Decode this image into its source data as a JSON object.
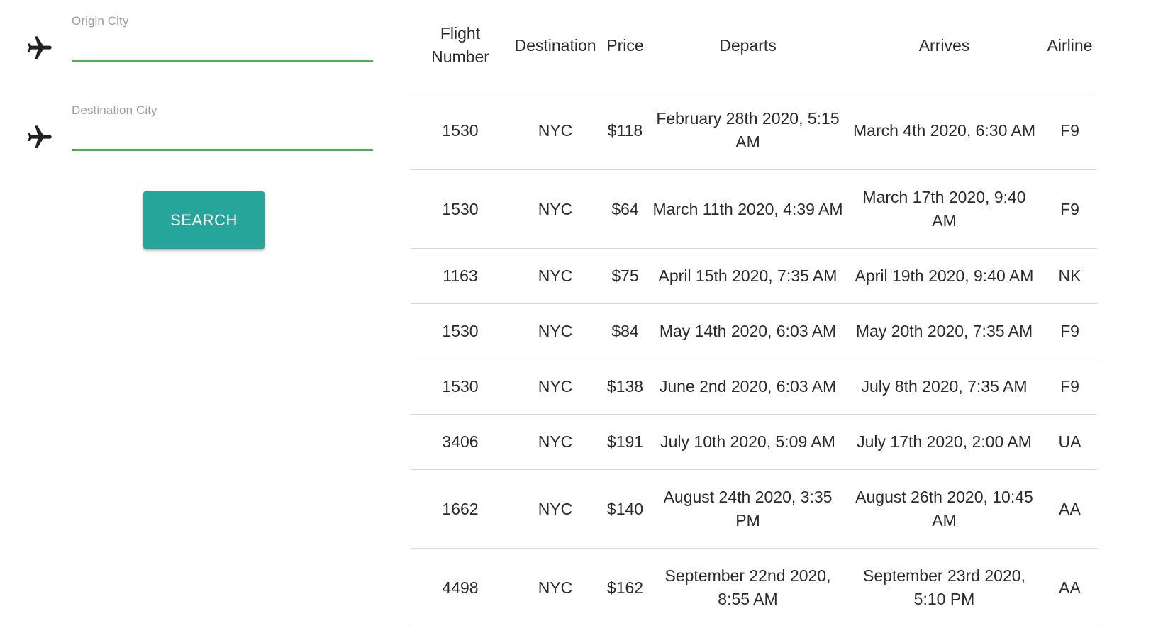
{
  "search": {
    "origin_label": "Origin City",
    "origin_value": "",
    "destination_label": "Destination City",
    "destination_value": "",
    "search_button": "SEARCH",
    "icon": "airplane-icon",
    "accent_color": "#26a69a",
    "underline_color": "#4caf50"
  },
  "table": {
    "headers": {
      "flight_number": "Flight Number",
      "destination": "Destination",
      "price": "Price",
      "departs": "Departs",
      "arrives": "Arrives",
      "airline": "Airline"
    },
    "rows": [
      {
        "flight": "1530",
        "destination": "NYC",
        "price": "$118",
        "departs": "February 28th 2020, 5:15 AM",
        "arrives": "March 4th 2020, 6:30 AM",
        "airline": "F9"
      },
      {
        "flight": "1530",
        "destination": "NYC",
        "price": "$64",
        "departs": "March 11th 2020, 4:39 AM",
        "arrives": "March 17th 2020, 9:40 AM",
        "airline": "F9"
      },
      {
        "flight": "1163",
        "destination": "NYC",
        "price": "$75",
        "departs": "April 15th 2020, 7:35 AM",
        "arrives": "April 19th 2020, 9:40 AM",
        "airline": "NK"
      },
      {
        "flight": "1530",
        "destination": "NYC",
        "price": "$84",
        "departs": "May 14th 2020, 6:03 AM",
        "arrives": "May 20th 2020, 7:35 AM",
        "airline": "F9"
      },
      {
        "flight": "1530",
        "destination": "NYC",
        "price": "$138",
        "departs": "June 2nd 2020, 6:03 AM",
        "arrives": "July 8th 2020, 7:35 AM",
        "airline": "F9"
      },
      {
        "flight": "3406",
        "destination": "NYC",
        "price": "$191",
        "departs": "July 10th 2020, 5:09 AM",
        "arrives": "July 17th 2020, 2:00 AM",
        "airline": "UA"
      },
      {
        "flight": "1662",
        "destination": "NYC",
        "price": "$140",
        "departs": "August 24th 2020, 3:35 PM",
        "arrives": "August 26th 2020, 10:45 AM",
        "airline": "AA"
      },
      {
        "flight": "4498",
        "destination": "NYC",
        "price": "$162",
        "departs": "September 22nd 2020, 8:55 AM",
        "arrives": "September 23rd 2020, 5:10 PM",
        "airline": "AA"
      }
    ]
  }
}
